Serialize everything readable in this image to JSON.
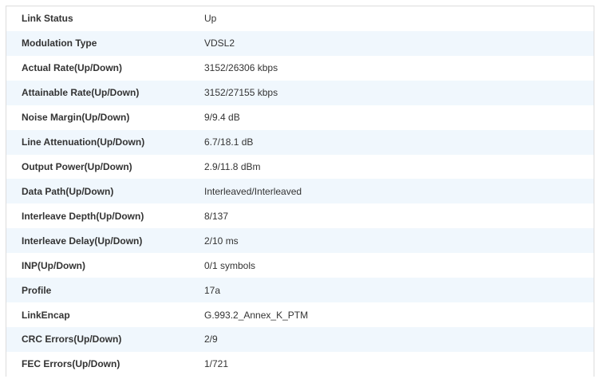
{
  "status_table": {
    "rows": [
      {
        "label": "Link Status",
        "value": "Up"
      },
      {
        "label": "Modulation Type",
        "value": "VDSL2"
      },
      {
        "label": "Actual Rate(Up/Down)",
        "value": "3152/26306 kbps"
      },
      {
        "label": "Attainable Rate(Up/Down)",
        "value": "3152/27155 kbps"
      },
      {
        "label": "Noise Margin(Up/Down)",
        "value": "9/9.4 dB"
      },
      {
        "label": "Line Attenuation(Up/Down)",
        "value": "6.7/18.1 dB"
      },
      {
        "label": "Output Power(Up/Down)",
        "value": "2.9/11.8 dBm"
      },
      {
        "label": "Data Path(Up/Down)",
        "value": "Interleaved/Interleaved"
      },
      {
        "label": "Interleave Depth(Up/Down)",
        "value": "8/137"
      },
      {
        "label": "Interleave Delay(Up/Down)",
        "value": "2/10 ms"
      },
      {
        "label": "INP(Up/Down)",
        "value": "0/1 symbols"
      },
      {
        "label": "Profile",
        "value": "17a"
      },
      {
        "label": "LinkEncap",
        "value": "G.993.2_Annex_K_PTM"
      },
      {
        "label": "CRC Errors(Up/Down)",
        "value": "2/9"
      },
      {
        "label": "FEC Errors(Up/Down)",
        "value": "1/721"
      }
    ]
  },
  "colors": {
    "row_alt_background": "#f0f7fd",
    "row_background": "#ffffff",
    "border": "#dcdcdc",
    "text": "#333333"
  }
}
